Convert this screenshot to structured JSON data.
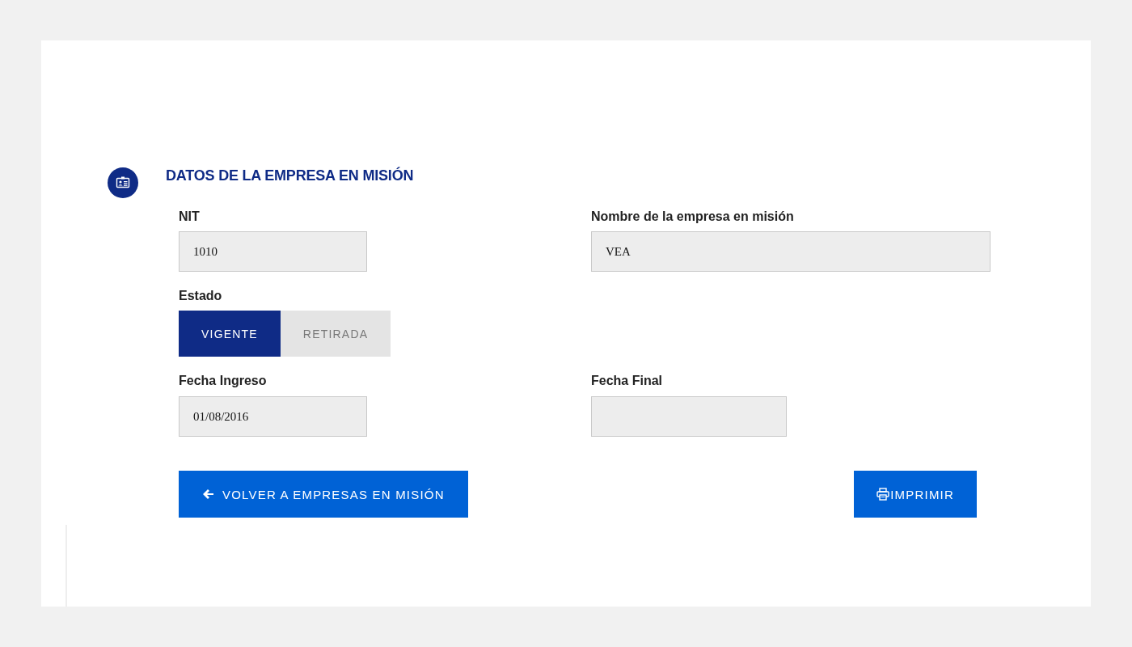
{
  "section": {
    "title": "DATOS DE LA EMPRESA EN MISIÓN",
    "rows": [
      [
        {
          "kind": "text",
          "label": "NIT",
          "value": "1010"
        },
        {
          "kind": "text",
          "label": "Nombre de la empresa en misión",
          "value": "VEA"
        }
      ],
      [
        {
          "kind": "toggle",
          "label": "Estado",
          "options": [
            {
              "label": "VIGENTE",
              "selected": true
            },
            {
              "label": "RETIRADA",
              "selected": false
            }
          ]
        }
      ],
      [
        {
          "kind": "text",
          "label": "Fecha Ingreso",
          "value": "01/08/2016"
        },
        {
          "kind": "text",
          "label": "Fecha Final"
        }
      ]
    ]
  },
  "actions": [
    {
      "kind": "back",
      "label": "VOLVER A EMPRESAS EN MISIÓN"
    },
    {
      "kind": "print",
      "label": "IMPRIMIR"
    }
  ]
}
